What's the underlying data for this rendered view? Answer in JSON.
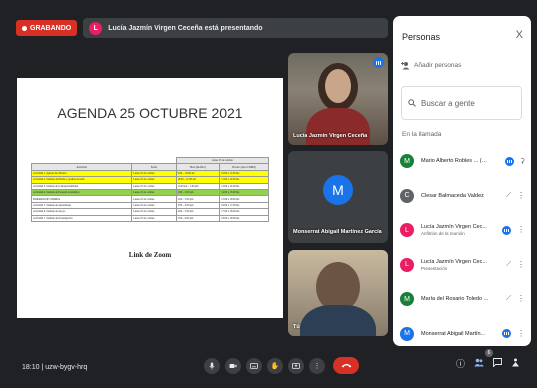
{
  "recording": {
    "label": "GRABANDO"
  },
  "presenting": {
    "avatar_initial": "L",
    "text": "Lucía Jazmín Virgen Ceceña está presentando"
  },
  "slide": {
    "title": "AGENDA 25 OCTUBRE 2021",
    "table": {
      "group_header": "Lunes 25 de octubre",
      "headers": [
        "Actividad",
        "Fecha",
        "Hora (Pacífico)",
        "Horario (hora CDMX)"
      ],
      "rows": [
        {
          "cells": [
            "Actividad 1. Ajustes del Modelo",
            "Lunes 25 de octubre",
            "9:00 – 10:00 am",
            "10:00 a 11:00 hrs"
          ],
          "highlight": "yellow"
        },
        {
          "cells": [
            "Actividad 2. Semana de Diseño y gestión docente",
            "Lunes 25 de octubre",
            "10:00 – 11:00 am",
            "11:00 a 12:00 hrs"
          ],
          "highlight": "yellow"
        },
        {
          "cells": [
            "Actividad 3. Semana de la Responsabilidad",
            "Lunes 25 de octubre",
            "11:00 am – 1:00 pm",
            "12:00 a 14:00 hrs"
          ],
          "highlight": ""
        },
        {
          "cells": [
            "Actividad 4. Semana de Personal Académico",
            "Lunes 25 de octubre",
            "1:00 – 2:00 pm",
            "14:00 a 15:00 hrs"
          ],
          "highlight": "green"
        },
        {
          "cells": [
            "HORARIO DE COMIDA",
            "Lunes 25 de octubre",
            "2:00 – 3:00 pm",
            "15:00 a 16:00 hrs"
          ],
          "highlight": ""
        },
        {
          "cells": [
            "Actividad 5. Semana de Aprendizaje",
            "Lunes 25 de octubre",
            "3:00 – 4:00 pm",
            "16:00 a 17:00 hrs"
          ],
          "highlight": ""
        },
        {
          "cells": [
            "Actividad 6. Semana de Apoyo",
            "Lunes 25 de octubre",
            "4:00 – 5:00 pm",
            "17:00 a 18:00 hrs"
          ],
          "highlight": ""
        },
        {
          "cells": [
            "Actividad 7. Semana de Investigación",
            "Lunes 25 de octubre",
            "5:00 – 6:00 pm",
            "18:00 a 19:00 hrs"
          ],
          "highlight": ""
        }
      ]
    },
    "link_text": "Link de Zoom"
  },
  "tiles": [
    {
      "name": "Lucía Jazmín Virgen Ceceña"
    },
    {
      "name": "Monserrat Abigail Martínez García",
      "initial": "M"
    },
    {
      "name": "Tú"
    }
  ],
  "panel": {
    "title": "Personas",
    "close": "X",
    "add_people": "Añadir personas",
    "search_placeholder": "Buscar a gente",
    "in_call": "En la llamada",
    "people": [
      {
        "initial": "M",
        "color": "#188038",
        "name": "Mario Alberto Robles ... (Tú)",
        "sub": ""
      },
      {
        "initial": "C",
        "color": "#5f6368",
        "name": "Clesar Balmaceda Valdez",
        "sub": ""
      },
      {
        "initial": "L",
        "color": "#e91e63",
        "name": "Lucía Jazmín Virgen Cec...",
        "sub": "Anfitrión de la reunión"
      },
      {
        "initial": "L",
        "color": "#e91e63",
        "name": "Lucía Jazmín Virgen Cec...",
        "sub": "Presentación"
      },
      {
        "initial": "M",
        "color": "#188038",
        "name": "María del Rosario Toledo ...",
        "sub": ""
      },
      {
        "initial": "M",
        "color": "#1a73e8",
        "name": "Monserrat Abigail Martín...",
        "sub": ""
      }
    ]
  },
  "bottom": {
    "clock": "18:10  |  uzw-bygv-hrq",
    "participants_count": "6"
  },
  "icons": {
    "mic": "microphone-icon",
    "camera": "camera-icon",
    "captions": "captions-icon",
    "hand": "raise-hand-icon",
    "present": "present-screen-icon",
    "more": "more-options-icon",
    "end": "end-call-icon",
    "info": "info-icon",
    "people": "people-icon",
    "chat": "chat-icon",
    "activities": "activities-icon"
  },
  "colors": {
    "record_red": "#d93025",
    "accent_blue": "#1a73e8",
    "dark_bg": "#202124"
  }
}
